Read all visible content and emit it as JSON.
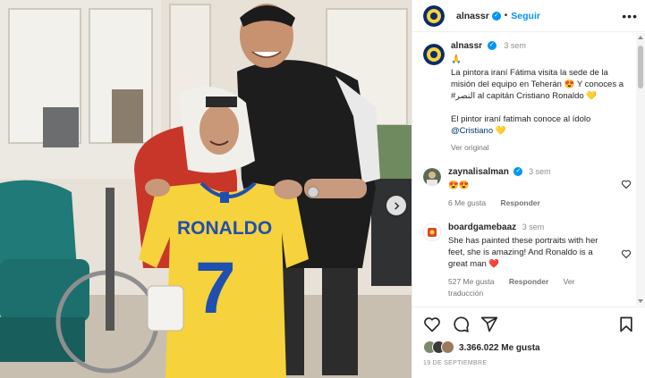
{
  "post": {
    "username": "alnassr",
    "follow_label": "Seguir",
    "more_label": "•••"
  },
  "caption": {
    "username": "alnassr",
    "time": "3 sem",
    "emoji_line": "🙏",
    "text_es": "La pintora iraní Fátima visita la sede de la misión del equipo en Teherán 😍 Y conoces a #النصر al capitán Cristiano Ronaldo 💛",
    "text_translated_prefix": "El pintor iraní fatimah conoce al ídolo ",
    "mention": "@Cristiano",
    "text_translated_suffix": " 💛",
    "see_original": "Ver original"
  },
  "comments": [
    {
      "username": "zaynalisalman",
      "time": "3 sem",
      "text": "😍😍",
      "likes": "6 Me gusta",
      "reply": "Responder",
      "translation": ""
    },
    {
      "username": "boardgamebaaz",
      "time": "3 sem",
      "text": "She has painted these portraits with her feet, she is amazing! And Ronaldo is a great man ❤️",
      "likes": "527 Me gusta",
      "reply": "Responder",
      "translation": "Ver traducción"
    }
  ],
  "photo": {
    "shirt_name": "RONALDO",
    "shirt_number": "7"
  },
  "footer": {
    "likes": "3.366.022 Me gusta",
    "date": "19 DE SEPTIEMBRE"
  },
  "colors": {
    "link_blue": "#0095f6",
    "shirt_yellow": "#f6d23c",
    "shirt_blue": "#1f4fb0",
    "heart_red": "#ed4956"
  },
  "icons": [
    "more-icon",
    "verified-icon",
    "heart-icon",
    "comment-icon",
    "share-icon",
    "bookmark-icon",
    "chevron-right-icon"
  ]
}
